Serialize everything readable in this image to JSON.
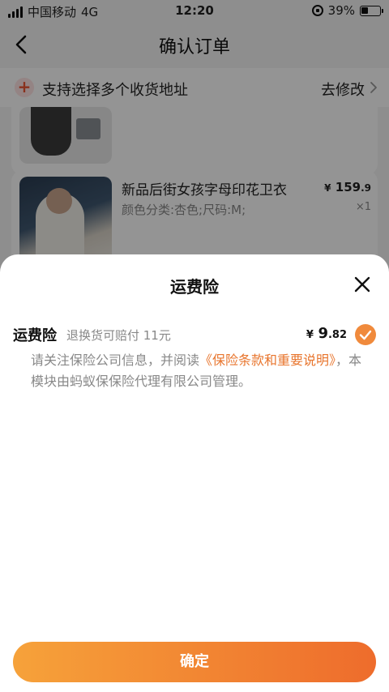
{
  "status_bar": {
    "carrier": "中国移动",
    "network": "4G",
    "time": "12:20",
    "battery": "39%"
  },
  "header": {
    "title": "确认订单"
  },
  "address": {
    "label": "支持选择多个收货地址",
    "action": "去修改"
  },
  "products": [
    {
      "title": "新品后街女孩字母印花卫衣",
      "attrs": "颜色分类:杏色;尺码:M;",
      "price_yen": "¥",
      "price_int": "159",
      "price_dec": ".9",
      "qty": "×1"
    }
  ],
  "sheet": {
    "title": "运费险",
    "insurance_name": "运费险",
    "insurance_desc": "退换货可赔付 11元",
    "price_yen": "¥",
    "price_int": "9",
    "price_dec": ".82",
    "checked": true,
    "notice_pre": "请关注保险公司信息，并阅读",
    "notice_link": "《保险条款和重要说明》",
    "notice_post": "，本模块由蚂蚁保保险代理有限公司管理。",
    "confirm_label": "确定"
  },
  "colors": {
    "accent": "#f08a3c",
    "button_start": "#f6a23a",
    "button_end": "#ee6c2c",
    "link": "#e8752d"
  },
  "icons": {
    "back": "chevron-left-icon",
    "add_address": "plus-icon",
    "chevron": "chevron-right-icon",
    "close": "close-icon",
    "checked": "check-icon"
  }
}
